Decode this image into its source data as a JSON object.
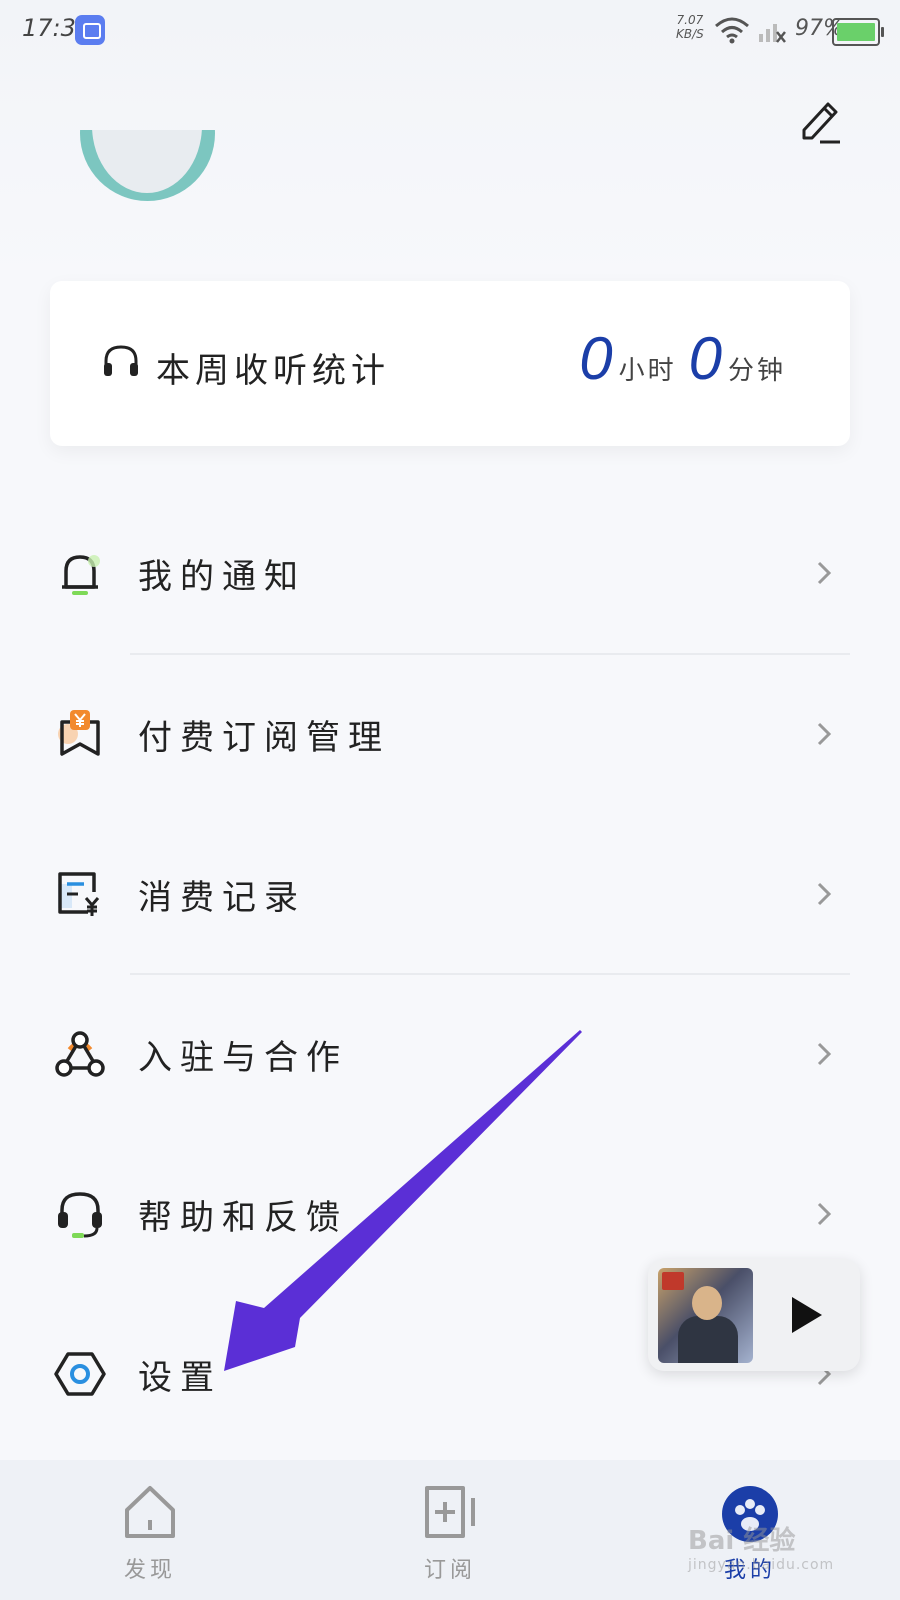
{
  "status": {
    "time": "17:38",
    "speed_value": "7.07",
    "speed_unit": "KB/S",
    "battery": "97%"
  },
  "stats": {
    "title": "本周收听统计",
    "hours": "0",
    "hours_unit": "小时",
    "minutes": "0",
    "minutes_unit": "分钟"
  },
  "menu": {
    "items": [
      {
        "label": "我的通知",
        "icon": "bell-icon"
      },
      {
        "label": "付费订阅管理",
        "icon": "paid-bookmark-icon"
      },
      {
        "label": "消费记录",
        "icon": "receipt-icon"
      },
      {
        "label": "入驻与合作",
        "icon": "cooperation-icon"
      },
      {
        "label": "帮助和反馈",
        "icon": "headset-icon"
      },
      {
        "label": "设置",
        "icon": "settings-hex-icon"
      }
    ]
  },
  "tabs": [
    {
      "label": "发现",
      "icon": "home-icon"
    },
    {
      "label": "订阅",
      "icon": "subscribe-icon"
    },
    {
      "label": "我的",
      "icon": "profile-icon"
    }
  ],
  "watermark": {
    "brand": "Bai 经验",
    "url": "jingyan.baidu.com"
  },
  "colors": {
    "accent": "#1b3ea8",
    "annotation_arrow": "#5b2fd6",
    "settings_dot": "#2a8fe0"
  }
}
